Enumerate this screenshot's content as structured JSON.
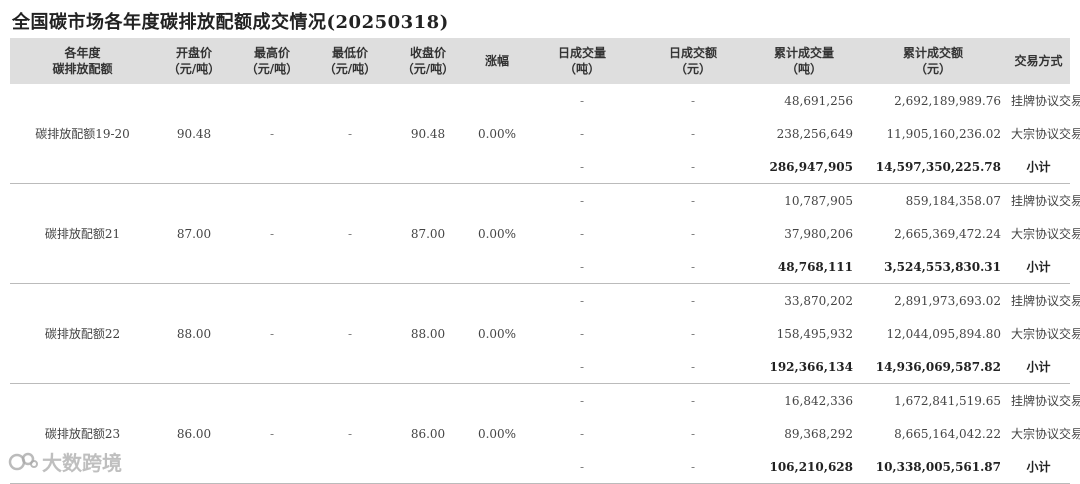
{
  "title": "全国碳市场各年度碳排放配额成交情况(20250318)",
  "headers": [
    [
      "各年度",
      "碳排放配额"
    ],
    [
      "开盘价",
      "（元/吨）"
    ],
    [
      "最高价",
      "（元/吨）"
    ],
    [
      "最低价",
      "（元/吨）"
    ],
    [
      "收盘价",
      "（元/吨）"
    ],
    [
      "涨幅",
      ""
    ],
    [
      "日成交量",
      "（吨）"
    ],
    [
      "日成交额",
      "（元）"
    ],
    [
      "累计成交量",
      "（吨）"
    ],
    [
      "累计成交额",
      "（元）"
    ],
    [
      "交易方式",
      ""
    ]
  ],
  "dash": "-",
  "groups": [
    {
      "name": "碳排放配额19-20",
      "open": "90.48",
      "high": "-",
      "low": "-",
      "close": "90.48",
      "change": "0.00%",
      "rows": [
        {
          "vol": "48,691,256",
          "amt": "2,692,189,989.76",
          "method": "挂牌协议交易"
        },
        {
          "vol": "238,256,649",
          "amt": "11,905,160,236.02",
          "method": "大宗协议交易"
        },
        {
          "vol": "286,947,905",
          "amt": "14,597,350,225.78",
          "method": "小计"
        }
      ]
    },
    {
      "name": "碳排放配额21",
      "open": "87.00",
      "high": "-",
      "low": "-",
      "close": "87.00",
      "change": "0.00%",
      "rows": [
        {
          "vol": "10,787,905",
          "amt": "859,184,358.07",
          "method": "挂牌协议交易"
        },
        {
          "vol": "37,980,206",
          "amt": "2,665,369,472.24",
          "method": "大宗协议交易"
        },
        {
          "vol": "48,768,111",
          "amt": "3,524,553,830.31",
          "method": "小计"
        }
      ]
    },
    {
      "name": "碳排放配额22",
      "open": "88.00",
      "high": "-",
      "low": "-",
      "close": "88.00",
      "change": "0.00%",
      "rows": [
        {
          "vol": "33,870,202",
          "amt": "2,891,973,693.02",
          "method": "挂牌协议交易"
        },
        {
          "vol": "158,495,932",
          "amt": "12,044,095,894.80",
          "method": "大宗协议交易"
        },
        {
          "vol": "192,366,134",
          "amt": "14,936,069,587.82",
          "method": "小计"
        }
      ]
    },
    {
      "name": "碳排放配额23",
      "open": "86.00",
      "high": "-",
      "low": "-",
      "close": "86.00",
      "change": "0.00%",
      "rows": [
        {
          "vol": "16,842,336",
          "amt": "1,672,841,519.65",
          "method": "挂牌协议交易"
        },
        {
          "vol": "89,368,292",
          "amt": "8,665,164,042.22",
          "method": "大宗协议交易"
        },
        {
          "vol": "106,210,628",
          "amt": "10,338,005,561.87",
          "method": "小计"
        }
      ]
    }
  ],
  "watermark": "大数跨境",
  "colors": {
    "header_bg": "#dedede",
    "divider": "#bbbbbb"
  }
}
